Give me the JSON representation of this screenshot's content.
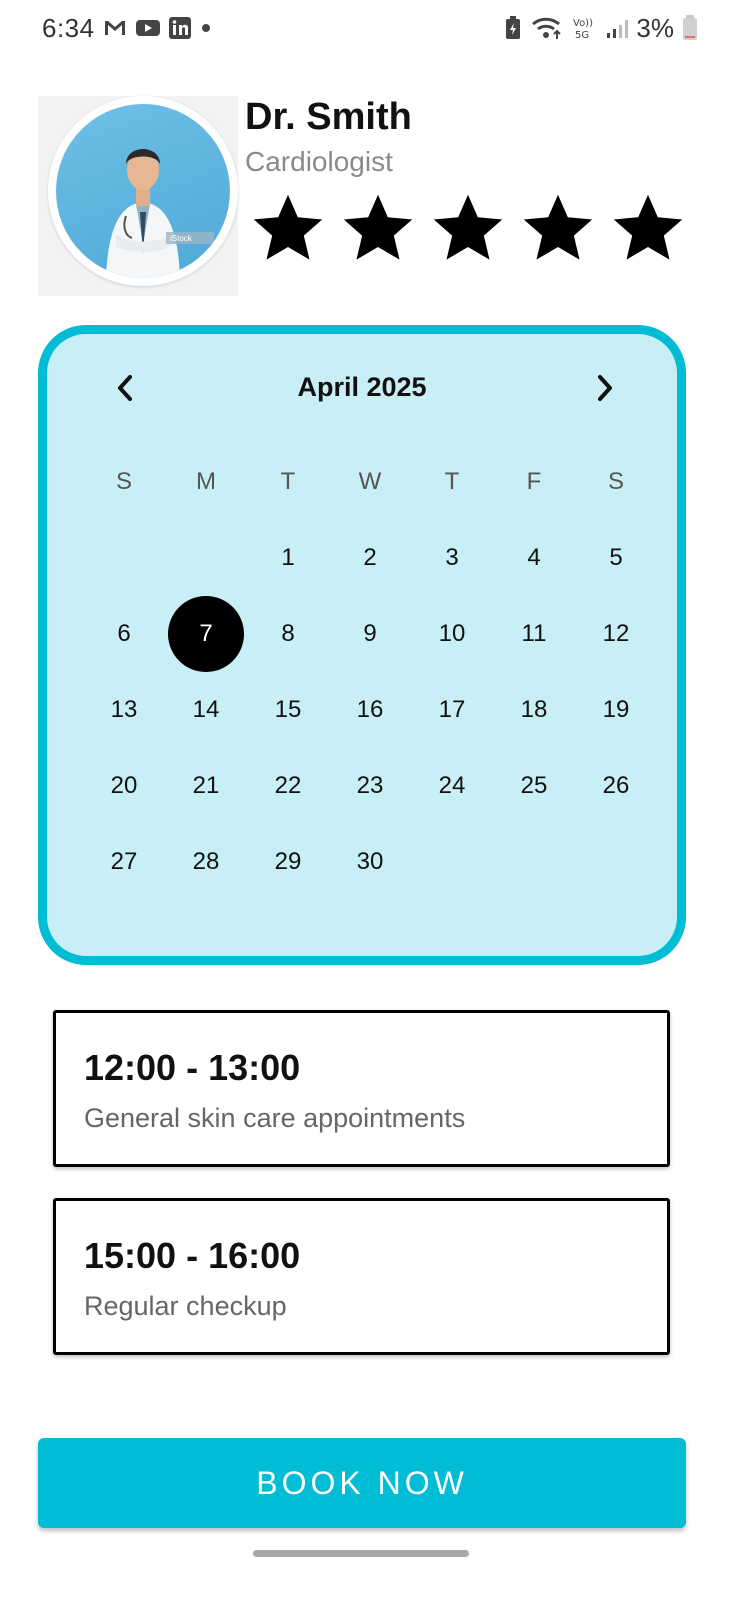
{
  "status_bar": {
    "time": "6:34",
    "battery_percent": "3%",
    "left_icons": [
      "gmail-icon",
      "youtube-icon",
      "linkedin-icon",
      "dot-icon"
    ],
    "right_icons": [
      "battery-saver-icon",
      "wifi-icon",
      "volte-5g-icon",
      "signal-icon",
      "battery-icon"
    ]
  },
  "doctor": {
    "name": "Dr. Smith",
    "specialty": "Cardiologist",
    "rating": 5,
    "rating_max": 5,
    "photo_watermark": "iStock"
  },
  "calendar": {
    "title": "April 2025",
    "weekdays": [
      "S",
      "M",
      "T",
      "W",
      "T",
      "F",
      "S"
    ],
    "weeks": [
      [
        "",
        "",
        "1",
        "2",
        "3",
        "4",
        "5"
      ],
      [
        "6",
        "7",
        "8",
        "9",
        "10",
        "11",
        "12"
      ],
      [
        "13",
        "14",
        "15",
        "16",
        "17",
        "18",
        "19"
      ],
      [
        "20",
        "21",
        "22",
        "23",
        "24",
        "25",
        "26"
      ],
      [
        "27",
        "28",
        "29",
        "30",
        "",
        "",
        ""
      ]
    ],
    "selected_day": "7"
  },
  "slots": [
    {
      "time": "12:00 - 13:00",
      "description": "General skin care appointments"
    },
    {
      "time": "15:00 - 16:00",
      "description": "Regular checkup"
    }
  ],
  "book_button": {
    "label": "BOOK NOW"
  },
  "colors": {
    "accent": "#00bcd4",
    "calendar_bg": "#c8eff6",
    "selected_day": "#000000"
  }
}
